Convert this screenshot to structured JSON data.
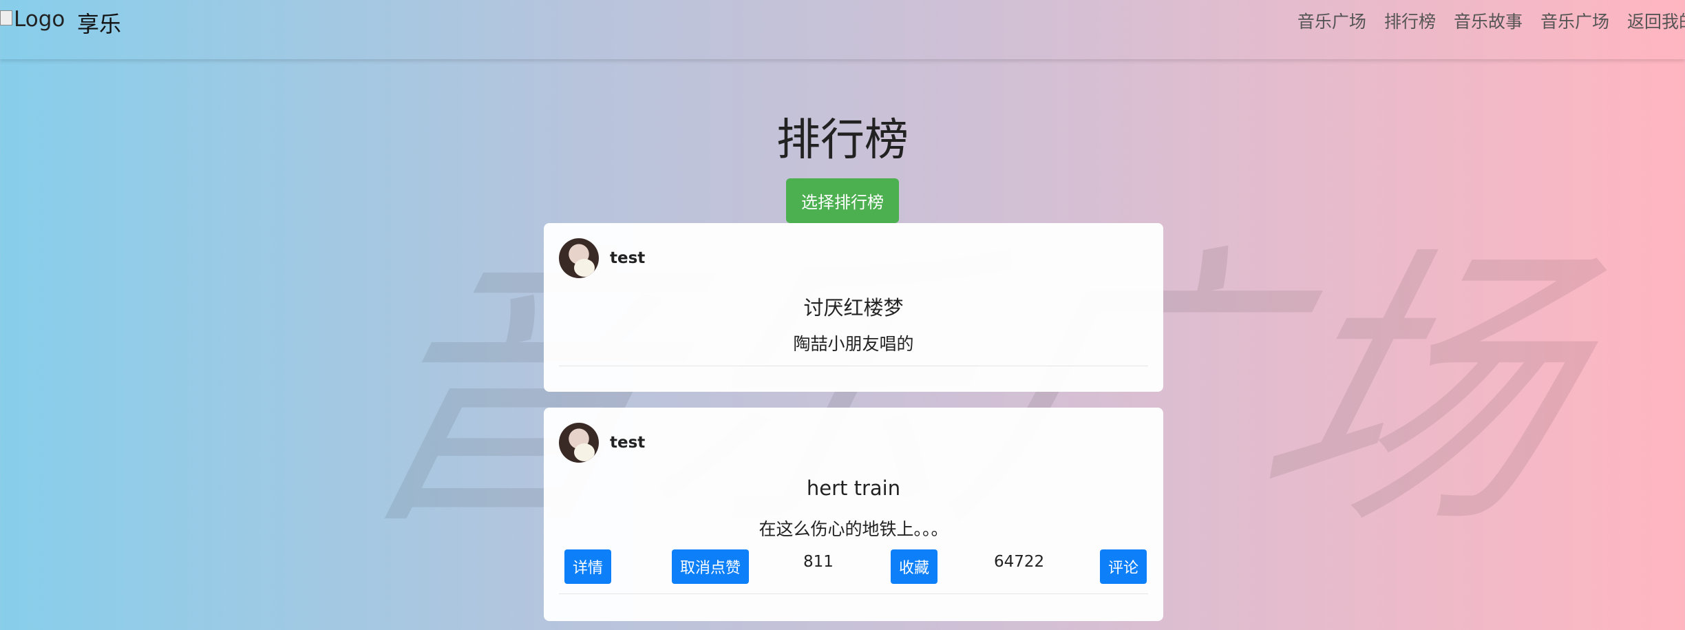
{
  "header": {
    "logo_alt": "Logo",
    "brand": "享乐",
    "nav": [
      "音乐广场",
      "排行榜",
      "音乐故事",
      "音乐广场",
      "返回我的"
    ]
  },
  "watermark": "音乐广场",
  "page": {
    "title": "排行榜",
    "select_button": "选择排行榜"
  },
  "songs": [
    {
      "username": "test",
      "title": "讨厌红楼梦",
      "description": "陶喆小朋友唱的"
    },
    {
      "username": "test",
      "title": "hert train",
      "description": "在这么伤心的地铁上。。。",
      "detail_label": "详情",
      "unlike_label": "取消点赞",
      "likes": "811",
      "favorite_label": "收藏",
      "favorites": "64722",
      "comment_label": "评论"
    }
  ],
  "colors": {
    "gradient_left": "#87ceeb",
    "gradient_right": "#ffb6c1",
    "select_button": "#4caf50",
    "action_button": "#0d7ff9"
  }
}
